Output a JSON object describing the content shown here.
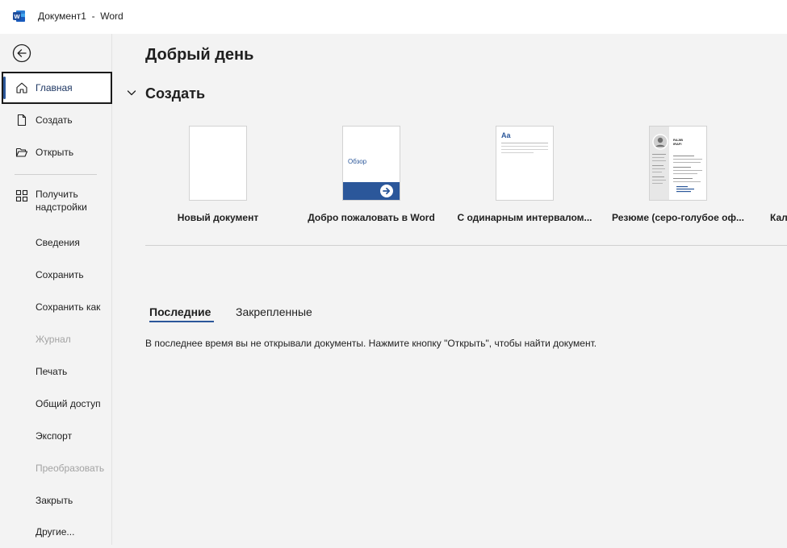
{
  "window": {
    "title": "Документ1  -  Word",
    "accent_color": "#2b579a"
  },
  "sidebar": {
    "back_icon": "back-arrow-icon",
    "items": [
      {
        "label": "Главная",
        "icon": "home-icon",
        "selected": true
      },
      {
        "label": "Создать",
        "icon": "new-document-icon"
      },
      {
        "label": "Открыть",
        "icon": "folder-open-icon"
      },
      {
        "label": "Получить\nнадстройки",
        "icon": "add-ins-grid-icon"
      },
      {
        "label": "Сведения"
      },
      {
        "label": "Сохранить"
      },
      {
        "label": "Сохранить как"
      },
      {
        "label": "Журнал",
        "disabled": true
      },
      {
        "label": "Печать"
      },
      {
        "label": "Общий доступ"
      },
      {
        "label": "Экспорт"
      },
      {
        "label": "Преобразовать",
        "disabled": true
      },
      {
        "label": "Закрыть"
      },
      {
        "label": "Другие..."
      }
    ]
  },
  "main": {
    "greeting": "Добрый день",
    "create_section": {
      "title": "Создать",
      "templates": [
        {
          "label": "Новый документ"
        },
        {
          "label": "Добро пожаловать в Word",
          "thumb_text": "Обзор"
        },
        {
          "label": "С одинарным интервалом...",
          "thumb_text": "Aa"
        },
        {
          "label": "Резюме (серо-голубое оф...",
          "thumb_text": "RAJIB\nIRAFI"
        },
        {
          "label": "Кал"
        }
      ]
    },
    "tabs": [
      {
        "label": "Последние",
        "active": true
      },
      {
        "label": "Закрепленные"
      }
    ],
    "empty_message": "В последнее время вы не открывали документы. Нажмите кнопку \"Открыть\", чтобы найти документ."
  }
}
